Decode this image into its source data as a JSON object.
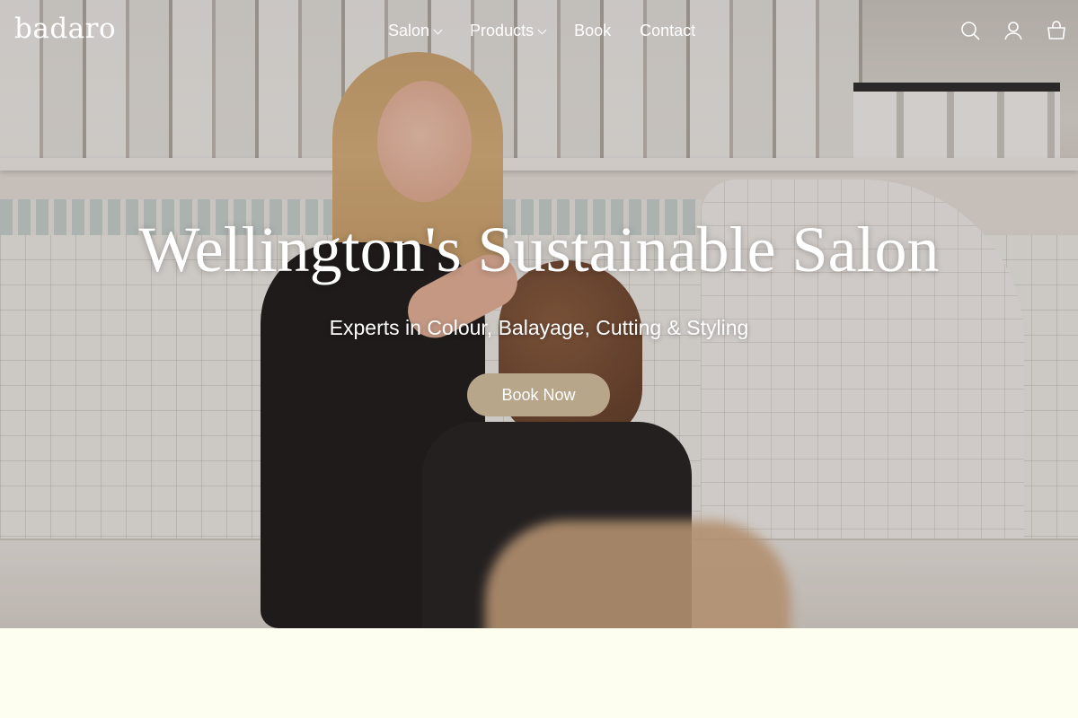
{
  "brand": {
    "logo": "badaro"
  },
  "nav": {
    "items": [
      {
        "label": "Salon",
        "has_dropdown": true
      },
      {
        "label": "Products",
        "has_dropdown": true
      },
      {
        "label": "Book",
        "has_dropdown": false
      },
      {
        "label": "Contact",
        "has_dropdown": false
      }
    ]
  },
  "header_icons": [
    "search-icon",
    "account-icon",
    "cart-icon"
  ],
  "hero": {
    "title": "Wellington's Sustainable Salon",
    "subtitle": "Experts in Colour, Balayage, Cutting & Styling",
    "cta_label": "Book Now",
    "image": "stylist-styling-client-hair-photo"
  },
  "colors": {
    "cta_background": "#b8a68b",
    "page_background": "#fdfef0",
    "header_text": "#ffffff"
  }
}
